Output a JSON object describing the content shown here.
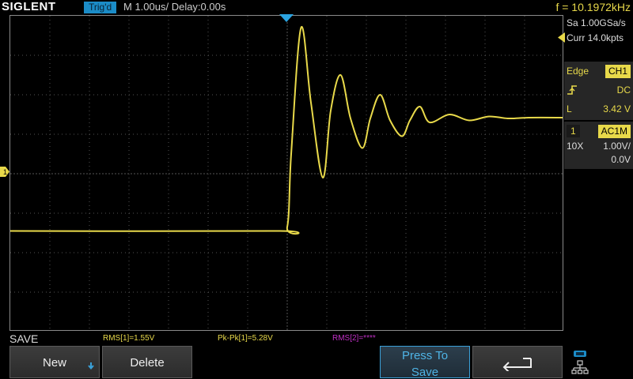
{
  "header": {
    "brand": "SIGLENT",
    "trigger_status": "Trig'd",
    "timebase": "M 1.00us/  Delay:0.00s",
    "frequency": "f = 10.1972kHz"
  },
  "side_panel": {
    "sample_rate": "Sa 1.00GSa/s",
    "memory_depth": "Curr 14.0kpts",
    "trigger": {
      "type": "Edge",
      "source": "CH1",
      "coupling": "DC",
      "level_label": "L",
      "level_value": "3.42 V"
    },
    "channel": {
      "number": "1",
      "coupling": "AC1M",
      "probe": "10X",
      "scale": "1.00V/",
      "offset": "0.0V"
    }
  },
  "measurements": {
    "menu_title": "SAVE",
    "items": [
      {
        "text": "RMS[1]=1.55V"
      },
      {
        "text": "Pk-Pk[1]=5.28V"
      },
      {
        "text": "RMS[2]=****"
      }
    ]
  },
  "softkeys": {
    "new_label": "New",
    "delete_label": "Delete",
    "save_label_line1": "Press To",
    "save_label_line2": "Save"
  },
  "icons": {
    "channel_marker": "ch1-offset-marker-icon",
    "trigger_position": "trigger-position-icon",
    "trigger_level": "trigger-level-icon",
    "rising_edge": "rising-edge-icon",
    "back": "back-arrow-icon",
    "network": "network-icon"
  },
  "colors": {
    "ch1": "#e8d94a",
    "accent": "#1b8cc7",
    "ch2_measurement": "#c02fc5"
  },
  "chart_data": {
    "type": "line",
    "series": [
      {
        "points_desc": "step response with damped ringing",
        "t_us": [
          -7.0,
          -0.3,
          0.0,
          0.1,
          0.35,
          0.6,
          0.9,
          1.1,
          1.35,
          1.6,
          1.9,
          2.1,
          2.35,
          2.6,
          2.9,
          3.1,
          3.35,
          3.6,
          4.1,
          4.6,
          5.1,
          5.6,
          6.1,
          7.0
        ],
        "v": [
          -1.45,
          -1.45,
          -1.35,
          0.5,
          3.7,
          1.8,
          -0.1,
          1.6,
          2.5,
          1.4,
          0.65,
          1.4,
          2.0,
          1.35,
          0.95,
          1.35,
          1.7,
          1.3,
          1.5,
          1.35,
          1.45,
          1.4,
          1.42,
          1.42
        ]
      }
    ],
    "xlim": [
      -7,
      7
    ],
    "ylim": [
      -4,
      4
    ],
    "grid": true
  }
}
